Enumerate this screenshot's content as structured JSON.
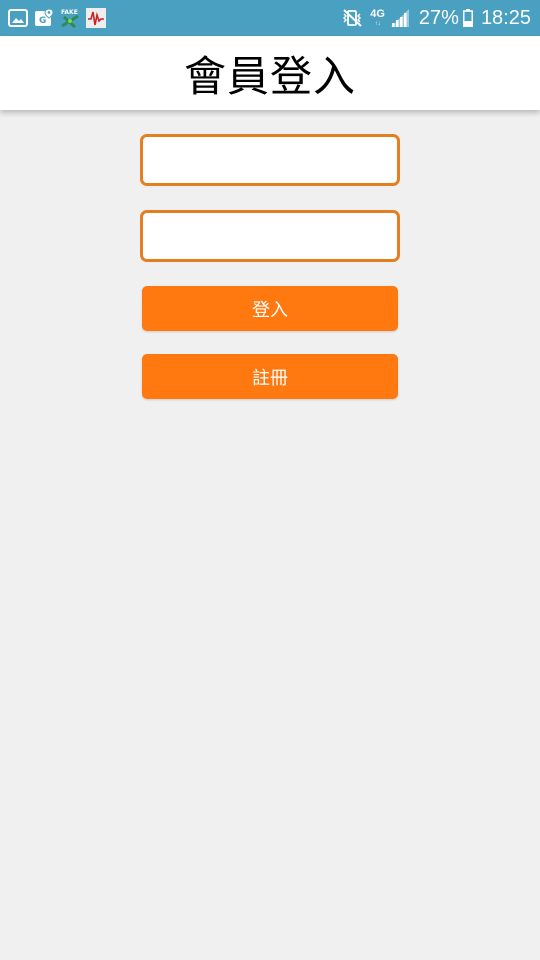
{
  "status_bar": {
    "left_icons": [
      "gallery-icon",
      "maps-icon",
      "fake-gps-icon",
      "voice-app-icon"
    ],
    "right_icons": [
      "mute-vibrate-icon",
      "network-4g-icon",
      "signal-icon",
      "battery-icon"
    ],
    "network_label": "4G",
    "battery_percent": "27%",
    "time": "18:25",
    "background_color": "#4aa0c0"
  },
  "header": {
    "title": "會員登入"
  },
  "form": {
    "username_value": "",
    "password_value": "",
    "login_label": "登入",
    "register_label": "註冊",
    "field_border_color": "#e57e20",
    "button_color": "#ff7810"
  }
}
